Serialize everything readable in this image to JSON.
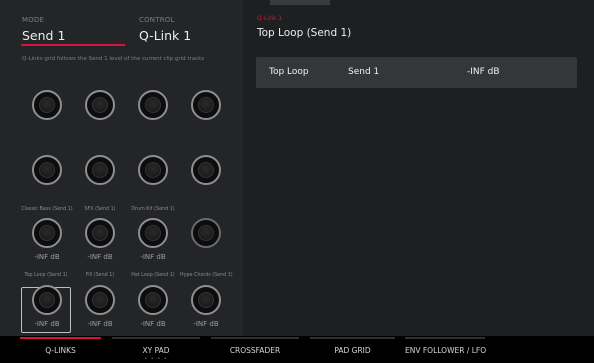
{
  "header": {
    "mode_label": "MODE",
    "mode_value": "Send 1",
    "control_label": "CONTROL",
    "control_value": "Q-Link 1",
    "hint": "Q-Links grid follows the Send 1 level of the current clip grid tracks"
  },
  "knobs": {
    "row3_names": [
      "Classic Bass (Send 1)",
      "SFX (Send 1)",
      "Drum Kit (Send 1)",
      ""
    ],
    "row3_values": [
      "-INF dB",
      "-INF dB",
      "-INF dB",
      ""
    ],
    "row4_names": [
      "Top Loop (Send 1)",
      "Fill (Send 1)",
      "Hat Loop (Send 1)",
      "Hype Chords (Send 1)"
    ],
    "row4_values": [
      "-INF dB",
      "-INF dB",
      "-INF dB",
      "-INF dB"
    ]
  },
  "detail": {
    "qlink_label": "Q-Link 1",
    "title": "Top Loop (Send 1)",
    "row": {
      "track": "Top Loop",
      "param": "Send 1",
      "value": "-INF dB"
    }
  },
  "tabs": [
    {
      "label": "Q-LINKS",
      "active": true,
      "dots": ""
    },
    {
      "label": "XY PAD",
      "active": false,
      "dots": "• • • •"
    },
    {
      "label": "CROSSFADER",
      "active": false,
      "dots": ""
    },
    {
      "label": "PAD GRID",
      "active": false,
      "dots": ""
    },
    {
      "label": "ENV FOLLOWER / LFO",
      "active": false,
      "dots": ""
    }
  ],
  "colors": {
    "accent": "#d0163d",
    "panel": "#242527",
    "background": "#1e1f21"
  }
}
